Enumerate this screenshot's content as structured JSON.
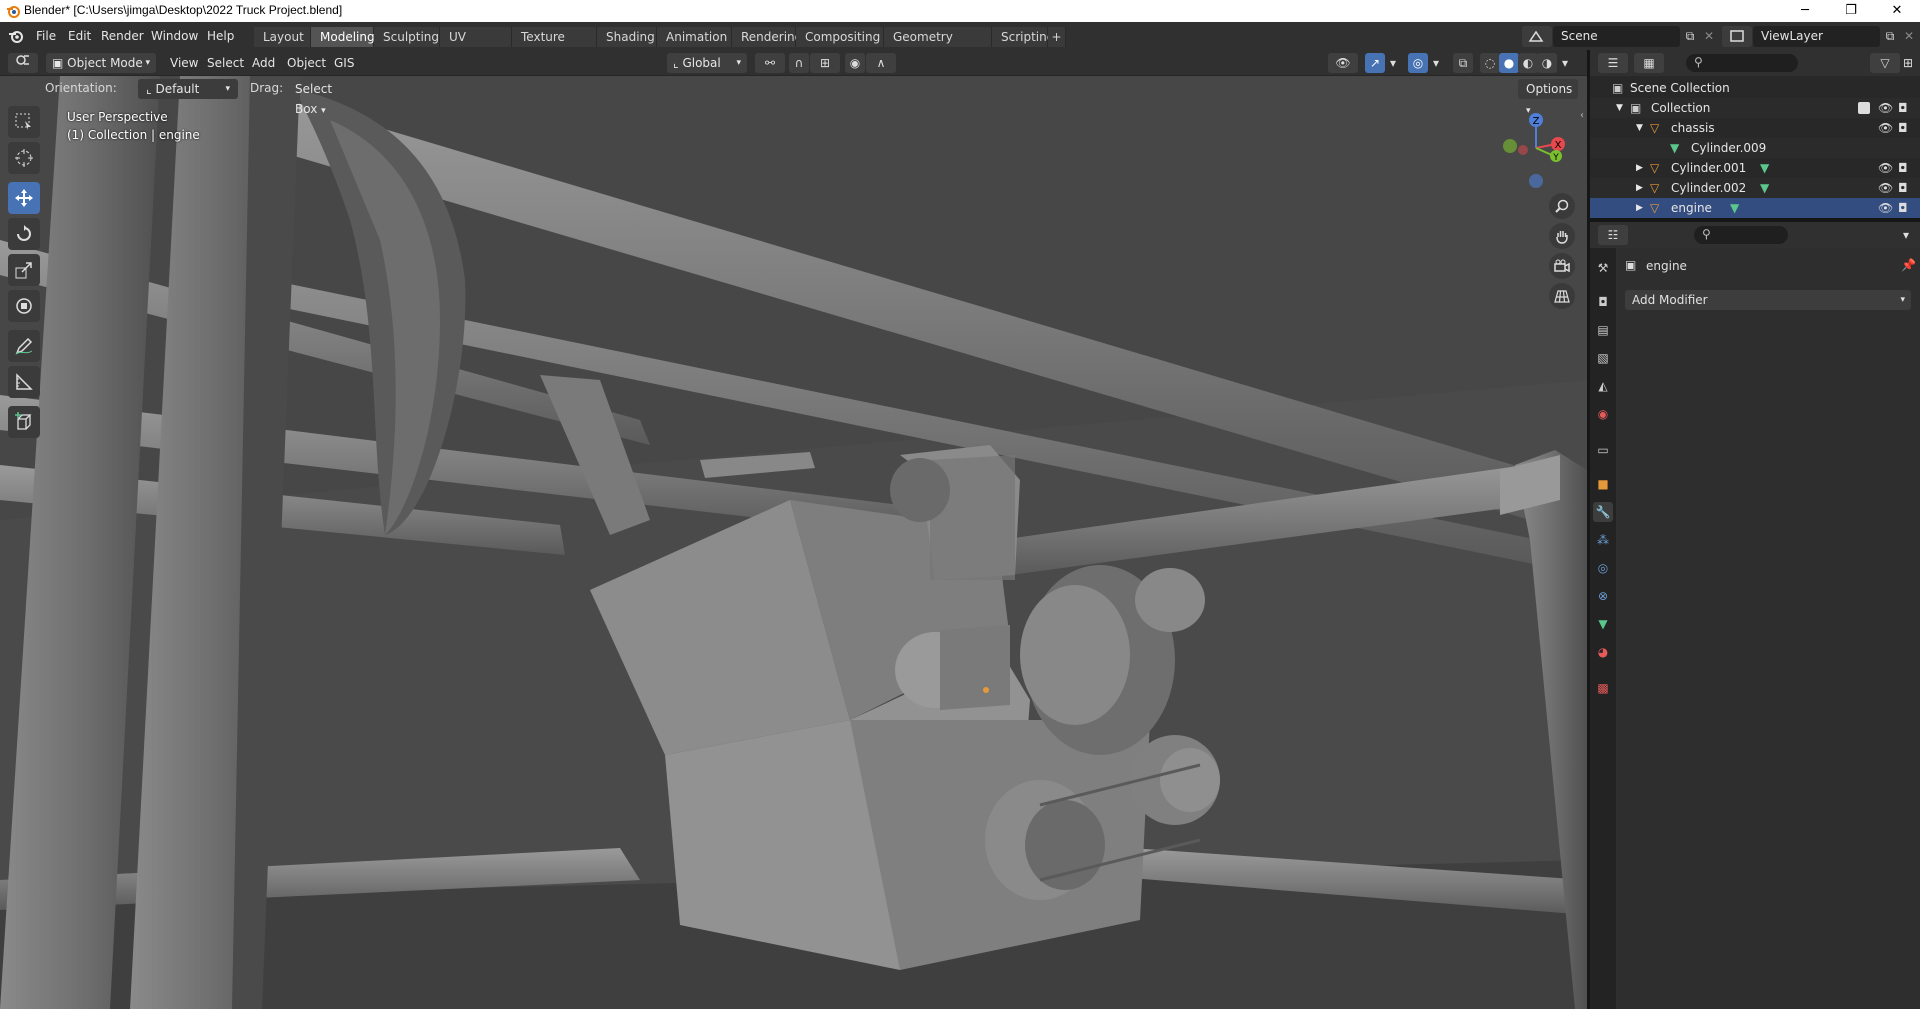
{
  "window": {
    "title": "Blender* [C:\\Users\\jimga\\Desktop\\2022 Truck Project.blend]",
    "min_glyph": "─",
    "max_glyph": "❐",
    "close_glyph": "✕"
  },
  "menu": {
    "items": [
      "File",
      "Edit",
      "Render",
      "Window",
      "Help"
    ]
  },
  "workspaces": {
    "tabs": [
      "Layout",
      "Modeling",
      "Sculpting",
      "UV Editing",
      "Texture Paint",
      "Shading",
      "Animation",
      "Rendering",
      "Compositing",
      "Geometry Nodes",
      "Scripting"
    ],
    "active": "Modeling",
    "add_glyph": "+"
  },
  "scene": {
    "name": "Scene",
    "view_layer": "ViewLayer"
  },
  "viewport_header": {
    "mode": "Object Mode",
    "menus": [
      "View",
      "Select",
      "Add",
      "Object",
      "GIS"
    ],
    "transform_orientation": "Global"
  },
  "tool_header": {
    "orientation_label": "Orientation:",
    "orientation_value": "Default",
    "drag_label": "Drag:",
    "drag_value": "Select Box",
    "options_label": "Options"
  },
  "viewport_overlay": {
    "view_name": "User Perspective",
    "context": "(1) Collection | engine"
  },
  "gizmo": {
    "x": "X",
    "y": "Y",
    "z": "Z"
  },
  "outliner": {
    "root": "Scene Collection",
    "rows": [
      {
        "label": "Collection",
        "indent": 1,
        "type": "collection"
      },
      {
        "label": "chassis",
        "indent": 2,
        "type": "object"
      },
      {
        "label": "Cylinder.009",
        "indent": 3,
        "type": "mesh"
      },
      {
        "label": "Cylinder.001",
        "indent": 2,
        "type": "object"
      },
      {
        "label": "Cylinder.002",
        "indent": 2,
        "type": "object"
      },
      {
        "label": "engine",
        "indent": 2,
        "type": "object"
      }
    ]
  },
  "properties": {
    "object_name": "engine",
    "add_modifier_label": "Add Modifier",
    "active_tab": "modifier-tab"
  },
  "colors": {
    "accent": "#4772b3",
    "object_orange": "#e59a3a",
    "mesh_green": "#5bc78d",
    "viewport_bg": "#474747"
  }
}
